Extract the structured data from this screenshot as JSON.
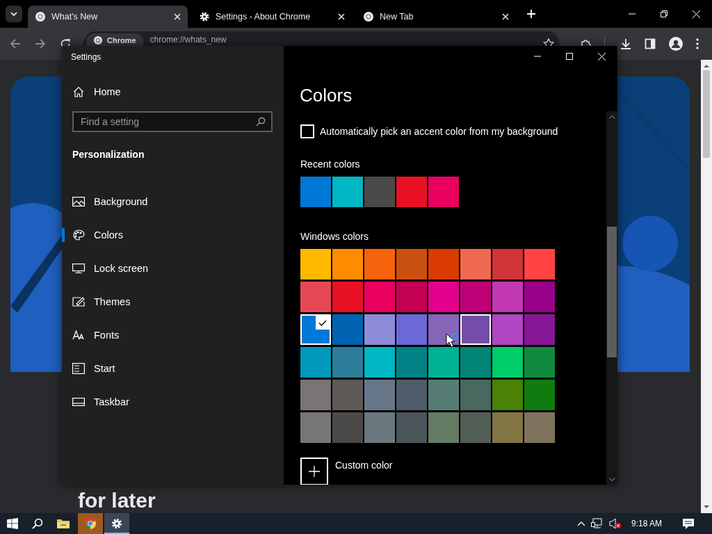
{
  "browser": {
    "tabs": [
      {
        "title": "What's New",
        "selected": true
      },
      {
        "title": "Settings - About Chrome",
        "selected": false
      },
      {
        "title": "New Tab",
        "selected": false
      }
    ],
    "address": {
      "chip": "Chrome",
      "url": "chrome://whats_new"
    },
    "page": {
      "heading": "for later"
    }
  },
  "settings": {
    "title": "Settings",
    "home": "Home",
    "search": {
      "placeholder": "Find a setting"
    },
    "section": "Personalization",
    "nav": [
      {
        "label": "Background",
        "selected": false
      },
      {
        "label": "Colors",
        "selected": true
      },
      {
        "label": "Lock screen",
        "selected": false
      },
      {
        "label": "Themes",
        "selected": false
      },
      {
        "label": "Fonts",
        "selected": false
      },
      {
        "label": "Start",
        "selected": false
      },
      {
        "label": "Taskbar",
        "selected": false
      }
    ],
    "heading": "Colors",
    "auto_accent": {
      "label": "Automatically pick an accent color from my background",
      "checked": false
    },
    "recent": {
      "label": "Recent colors",
      "swatches": [
        {
          "color": "#0078d7"
        },
        {
          "color": "#00b7c3"
        },
        {
          "color": "#4c4a48"
        },
        {
          "color": "#e81123"
        },
        {
          "color": "#ea005e"
        }
      ]
    },
    "windows": {
      "label": "Windows colors",
      "swatches": [
        {
          "color": "#ffb900",
          "selected": false,
          "hovered": false
        },
        {
          "color": "#ff8c00",
          "selected": false,
          "hovered": false
        },
        {
          "color": "#f7630c",
          "selected": false,
          "hovered": false
        },
        {
          "color": "#ca5010",
          "selected": false,
          "hovered": false
        },
        {
          "color": "#da3b01",
          "selected": false,
          "hovered": false
        },
        {
          "color": "#ef6950",
          "selected": false,
          "hovered": false
        },
        {
          "color": "#d13438",
          "selected": false,
          "hovered": false
        },
        {
          "color": "#ff4343",
          "selected": false,
          "hovered": false
        },
        {
          "color": "#e74856",
          "selected": false,
          "hovered": false
        },
        {
          "color": "#e81123",
          "selected": false,
          "hovered": false
        },
        {
          "color": "#ea005e",
          "selected": false,
          "hovered": false
        },
        {
          "color": "#c30052",
          "selected": false,
          "hovered": false
        },
        {
          "color": "#e3008c",
          "selected": false,
          "hovered": false
        },
        {
          "color": "#bf0077",
          "selected": false,
          "hovered": false
        },
        {
          "color": "#c239b3",
          "selected": false,
          "hovered": false
        },
        {
          "color": "#9a0089",
          "selected": false,
          "hovered": false
        },
        {
          "color": "#0078d7",
          "selected": true,
          "hovered": false
        },
        {
          "color": "#0063b1",
          "selected": false,
          "hovered": false
        },
        {
          "color": "#8e8cd8",
          "selected": false,
          "hovered": false
        },
        {
          "color": "#6b69d6",
          "selected": false,
          "hovered": false
        },
        {
          "color": "#8764b8",
          "selected": false,
          "hovered": false
        },
        {
          "color": "#744da9",
          "selected": false,
          "hovered": true
        },
        {
          "color": "#b146c2",
          "selected": false,
          "hovered": false
        },
        {
          "color": "#881798",
          "selected": false,
          "hovered": false
        },
        {
          "color": "#0099bc",
          "selected": false,
          "hovered": false
        },
        {
          "color": "#2d7d9a",
          "selected": false,
          "hovered": false
        },
        {
          "color": "#00b7c3",
          "selected": false,
          "hovered": false
        },
        {
          "color": "#038387",
          "selected": false,
          "hovered": false
        },
        {
          "color": "#00b294",
          "selected": false,
          "hovered": false
        },
        {
          "color": "#018574",
          "selected": false,
          "hovered": false
        },
        {
          "color": "#00cc6a",
          "selected": false,
          "hovered": false
        },
        {
          "color": "#10893e",
          "selected": false,
          "hovered": false
        },
        {
          "color": "#7a7574",
          "selected": false,
          "hovered": false
        },
        {
          "color": "#5d5a58",
          "selected": false,
          "hovered": false
        },
        {
          "color": "#68768a",
          "selected": false,
          "hovered": false
        },
        {
          "color": "#515c6b",
          "selected": false,
          "hovered": false
        },
        {
          "color": "#567c73",
          "selected": false,
          "hovered": false
        },
        {
          "color": "#486860",
          "selected": false,
          "hovered": false
        },
        {
          "color": "#498205",
          "selected": false,
          "hovered": false
        },
        {
          "color": "#107c10",
          "selected": false,
          "hovered": false
        },
        {
          "color": "#767676",
          "selected": false,
          "hovered": false
        },
        {
          "color": "#4c4a48",
          "selected": false,
          "hovered": false
        },
        {
          "color": "#69797e",
          "selected": false,
          "hovered": false
        },
        {
          "color": "#4a5459",
          "selected": false,
          "hovered": false
        },
        {
          "color": "#647c64",
          "selected": false,
          "hovered": false
        },
        {
          "color": "#525e54",
          "selected": false,
          "hovered": false
        },
        {
          "color": "#847545",
          "selected": false,
          "hovered": false
        },
        {
          "color": "#7e735f",
          "selected": false,
          "hovered": false
        }
      ]
    },
    "custom": "Custom color"
  },
  "taskbar": {
    "apps": [
      {
        "active": false,
        "flashing": false
      },
      {
        "active": false,
        "flashing": false
      },
      {
        "active": false,
        "flashing": false
      },
      {
        "active": false,
        "flashing": true
      },
      {
        "active": true,
        "flashing": false
      }
    ],
    "time": "9:18 AM"
  }
}
